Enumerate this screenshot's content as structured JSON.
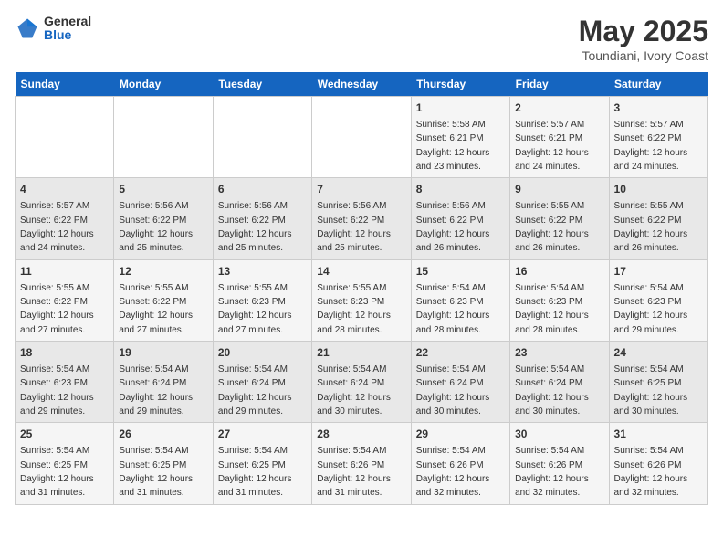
{
  "header": {
    "logo_general": "General",
    "logo_blue": "Blue",
    "title": "May 2025",
    "subtitle": "Toundiani, Ivory Coast"
  },
  "weekdays": [
    "Sunday",
    "Monday",
    "Tuesday",
    "Wednesday",
    "Thursday",
    "Friday",
    "Saturday"
  ],
  "weeks": [
    [
      {
        "day": "",
        "detail": ""
      },
      {
        "day": "",
        "detail": ""
      },
      {
        "day": "",
        "detail": ""
      },
      {
        "day": "",
        "detail": ""
      },
      {
        "day": "1",
        "detail": "Sunrise: 5:58 AM\nSunset: 6:21 PM\nDaylight: 12 hours\nand 23 minutes."
      },
      {
        "day": "2",
        "detail": "Sunrise: 5:57 AM\nSunset: 6:21 PM\nDaylight: 12 hours\nand 24 minutes."
      },
      {
        "day": "3",
        "detail": "Sunrise: 5:57 AM\nSunset: 6:22 PM\nDaylight: 12 hours\nand 24 minutes."
      }
    ],
    [
      {
        "day": "4",
        "detail": "Sunrise: 5:57 AM\nSunset: 6:22 PM\nDaylight: 12 hours\nand 24 minutes."
      },
      {
        "day": "5",
        "detail": "Sunrise: 5:56 AM\nSunset: 6:22 PM\nDaylight: 12 hours\nand 25 minutes."
      },
      {
        "day": "6",
        "detail": "Sunrise: 5:56 AM\nSunset: 6:22 PM\nDaylight: 12 hours\nand 25 minutes."
      },
      {
        "day": "7",
        "detail": "Sunrise: 5:56 AM\nSunset: 6:22 PM\nDaylight: 12 hours\nand 25 minutes."
      },
      {
        "day": "8",
        "detail": "Sunrise: 5:56 AM\nSunset: 6:22 PM\nDaylight: 12 hours\nand 26 minutes."
      },
      {
        "day": "9",
        "detail": "Sunrise: 5:55 AM\nSunset: 6:22 PM\nDaylight: 12 hours\nand 26 minutes."
      },
      {
        "day": "10",
        "detail": "Sunrise: 5:55 AM\nSunset: 6:22 PM\nDaylight: 12 hours\nand 26 minutes."
      }
    ],
    [
      {
        "day": "11",
        "detail": "Sunrise: 5:55 AM\nSunset: 6:22 PM\nDaylight: 12 hours\nand 27 minutes."
      },
      {
        "day": "12",
        "detail": "Sunrise: 5:55 AM\nSunset: 6:22 PM\nDaylight: 12 hours\nand 27 minutes."
      },
      {
        "day": "13",
        "detail": "Sunrise: 5:55 AM\nSunset: 6:23 PM\nDaylight: 12 hours\nand 27 minutes."
      },
      {
        "day": "14",
        "detail": "Sunrise: 5:55 AM\nSunset: 6:23 PM\nDaylight: 12 hours\nand 28 minutes."
      },
      {
        "day": "15",
        "detail": "Sunrise: 5:54 AM\nSunset: 6:23 PM\nDaylight: 12 hours\nand 28 minutes."
      },
      {
        "day": "16",
        "detail": "Sunrise: 5:54 AM\nSunset: 6:23 PM\nDaylight: 12 hours\nand 28 minutes."
      },
      {
        "day": "17",
        "detail": "Sunrise: 5:54 AM\nSunset: 6:23 PM\nDaylight: 12 hours\nand 29 minutes."
      }
    ],
    [
      {
        "day": "18",
        "detail": "Sunrise: 5:54 AM\nSunset: 6:23 PM\nDaylight: 12 hours\nand 29 minutes."
      },
      {
        "day": "19",
        "detail": "Sunrise: 5:54 AM\nSunset: 6:24 PM\nDaylight: 12 hours\nand 29 minutes."
      },
      {
        "day": "20",
        "detail": "Sunrise: 5:54 AM\nSunset: 6:24 PM\nDaylight: 12 hours\nand 29 minutes."
      },
      {
        "day": "21",
        "detail": "Sunrise: 5:54 AM\nSunset: 6:24 PM\nDaylight: 12 hours\nand 30 minutes."
      },
      {
        "day": "22",
        "detail": "Sunrise: 5:54 AM\nSunset: 6:24 PM\nDaylight: 12 hours\nand 30 minutes."
      },
      {
        "day": "23",
        "detail": "Sunrise: 5:54 AM\nSunset: 6:24 PM\nDaylight: 12 hours\nand 30 minutes."
      },
      {
        "day": "24",
        "detail": "Sunrise: 5:54 AM\nSunset: 6:25 PM\nDaylight: 12 hours\nand 30 minutes."
      }
    ],
    [
      {
        "day": "25",
        "detail": "Sunrise: 5:54 AM\nSunset: 6:25 PM\nDaylight: 12 hours\nand 31 minutes."
      },
      {
        "day": "26",
        "detail": "Sunrise: 5:54 AM\nSunset: 6:25 PM\nDaylight: 12 hours\nand 31 minutes."
      },
      {
        "day": "27",
        "detail": "Sunrise: 5:54 AM\nSunset: 6:25 PM\nDaylight: 12 hours\nand 31 minutes."
      },
      {
        "day": "28",
        "detail": "Sunrise: 5:54 AM\nSunset: 6:26 PM\nDaylight: 12 hours\nand 31 minutes."
      },
      {
        "day": "29",
        "detail": "Sunrise: 5:54 AM\nSunset: 6:26 PM\nDaylight: 12 hours\nand 32 minutes."
      },
      {
        "day": "30",
        "detail": "Sunrise: 5:54 AM\nSunset: 6:26 PM\nDaylight: 12 hours\nand 32 minutes."
      },
      {
        "day": "31",
        "detail": "Sunrise: 5:54 AM\nSunset: 6:26 PM\nDaylight: 12 hours\nand 32 minutes."
      }
    ]
  ]
}
